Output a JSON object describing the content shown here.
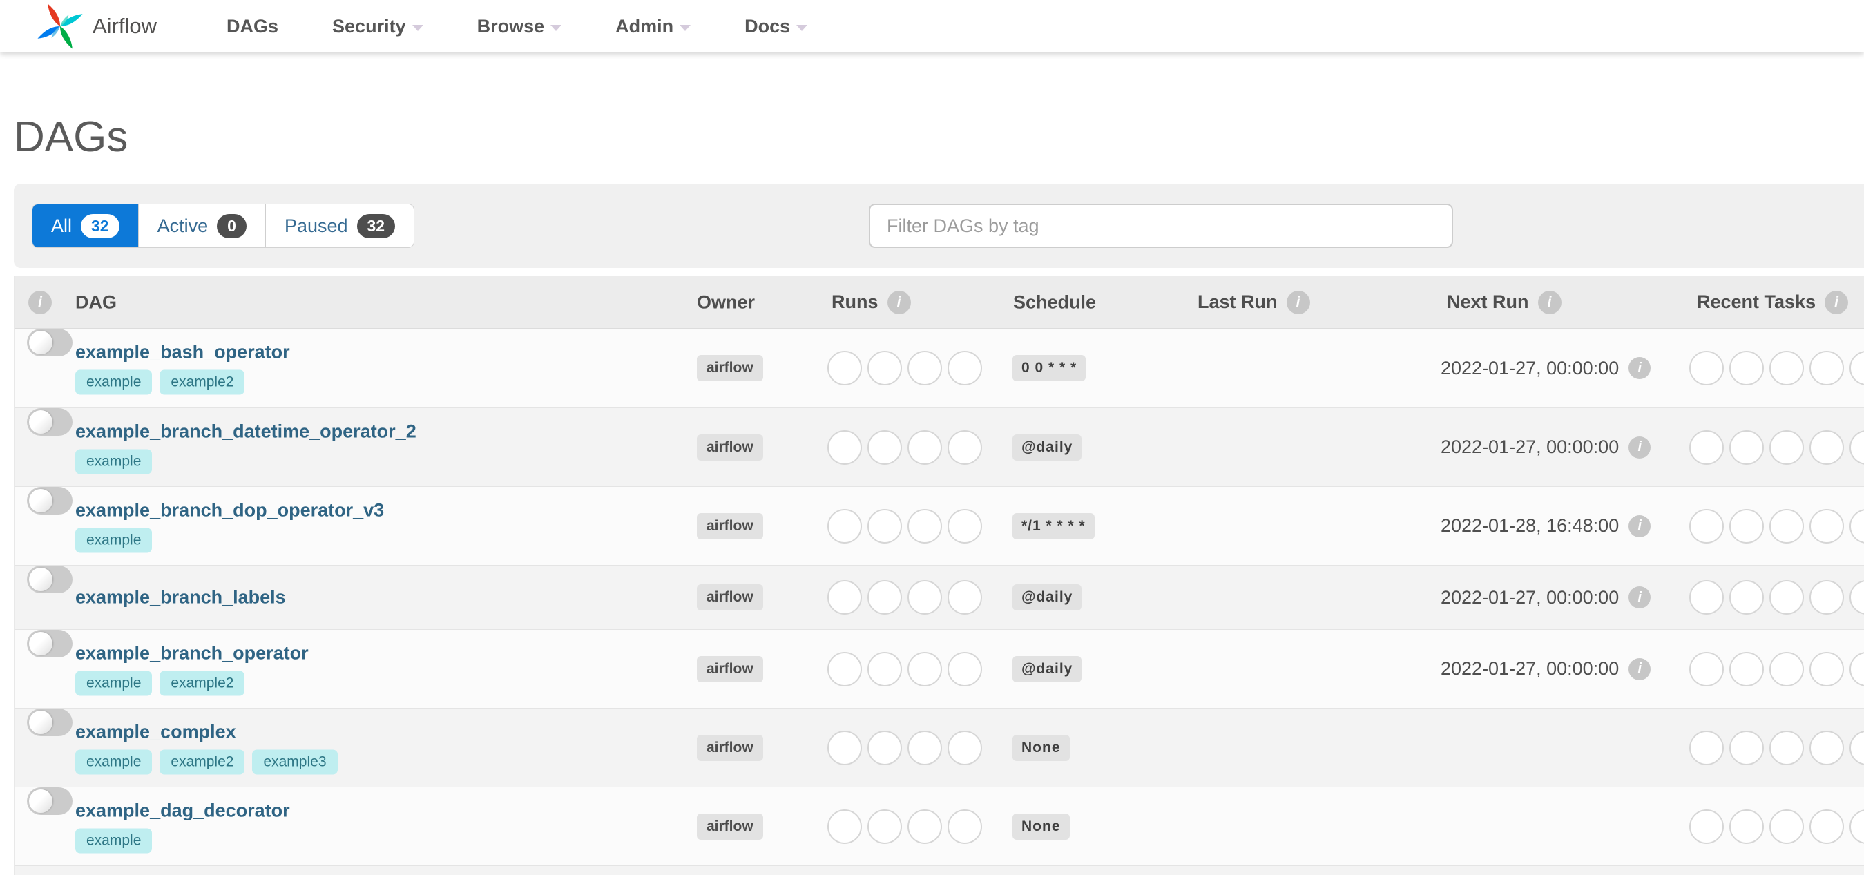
{
  "nav": {
    "brand": "Airflow",
    "items": [
      {
        "label": "DAGs",
        "has_caret": false
      },
      {
        "label": "Security",
        "has_caret": true
      },
      {
        "label": "Browse",
        "has_caret": true
      },
      {
        "label": "Admin",
        "has_caret": true
      },
      {
        "label": "Docs",
        "has_caret": true
      }
    ]
  },
  "page": {
    "title": "DAGs"
  },
  "filters": {
    "tabs": [
      {
        "label": "All",
        "count": "32",
        "active": true
      },
      {
        "label": "Active",
        "count": "0",
        "active": false
      },
      {
        "label": "Paused",
        "count": "32",
        "active": false
      }
    ],
    "search_placeholder": "Filter DAGs by tag"
  },
  "table": {
    "columns": {
      "dag": "DAG",
      "owner": "Owner",
      "runs": "Runs",
      "schedule": "Schedule",
      "last_run": "Last Run",
      "next_run": "Next Run",
      "recent_tasks": "Recent Tasks"
    },
    "runs_slots": 4,
    "recent_slots": 5,
    "rows": [
      {
        "name": "example_bash_operator",
        "tags": [
          "example",
          "example2"
        ],
        "owner": "airflow",
        "schedule": "0 0 * * *",
        "next_run": "2022-01-27, 00:00:00",
        "paused": true
      },
      {
        "name": "example_branch_datetime_operator_2",
        "tags": [
          "example"
        ],
        "owner": "airflow",
        "schedule": "@daily",
        "next_run": "2022-01-27, 00:00:00",
        "paused": true
      },
      {
        "name": "example_branch_dop_operator_v3",
        "tags": [
          "example"
        ],
        "owner": "airflow",
        "schedule": "*/1 * * * *",
        "next_run": "2022-01-28, 16:48:00",
        "paused": true
      },
      {
        "name": "example_branch_labels",
        "tags": [],
        "owner": "airflow",
        "schedule": "@daily",
        "next_run": "2022-01-27, 00:00:00",
        "paused": true
      },
      {
        "name": "example_branch_operator",
        "tags": [
          "example",
          "example2"
        ],
        "owner": "airflow",
        "schedule": "@daily",
        "next_run": "2022-01-27, 00:00:00",
        "paused": true
      },
      {
        "name": "example_complex",
        "tags": [
          "example",
          "example2",
          "example3"
        ],
        "owner": "airflow",
        "schedule": "None",
        "next_run": "",
        "paused": true
      },
      {
        "name": "example_dag_decorator",
        "tags": [
          "example"
        ],
        "owner": "airflow",
        "schedule": "None",
        "next_run": "",
        "paused": true
      }
    ]
  },
  "colors": {
    "accent_blue": "#0d79d8",
    "tag_background": "#bfeef0",
    "tag_text": "#2d7685",
    "logo_red": "#e43921",
    "logo_teal": "#00c7d4",
    "logo_green": "#00ad46",
    "logo_blue": "#017cee"
  }
}
